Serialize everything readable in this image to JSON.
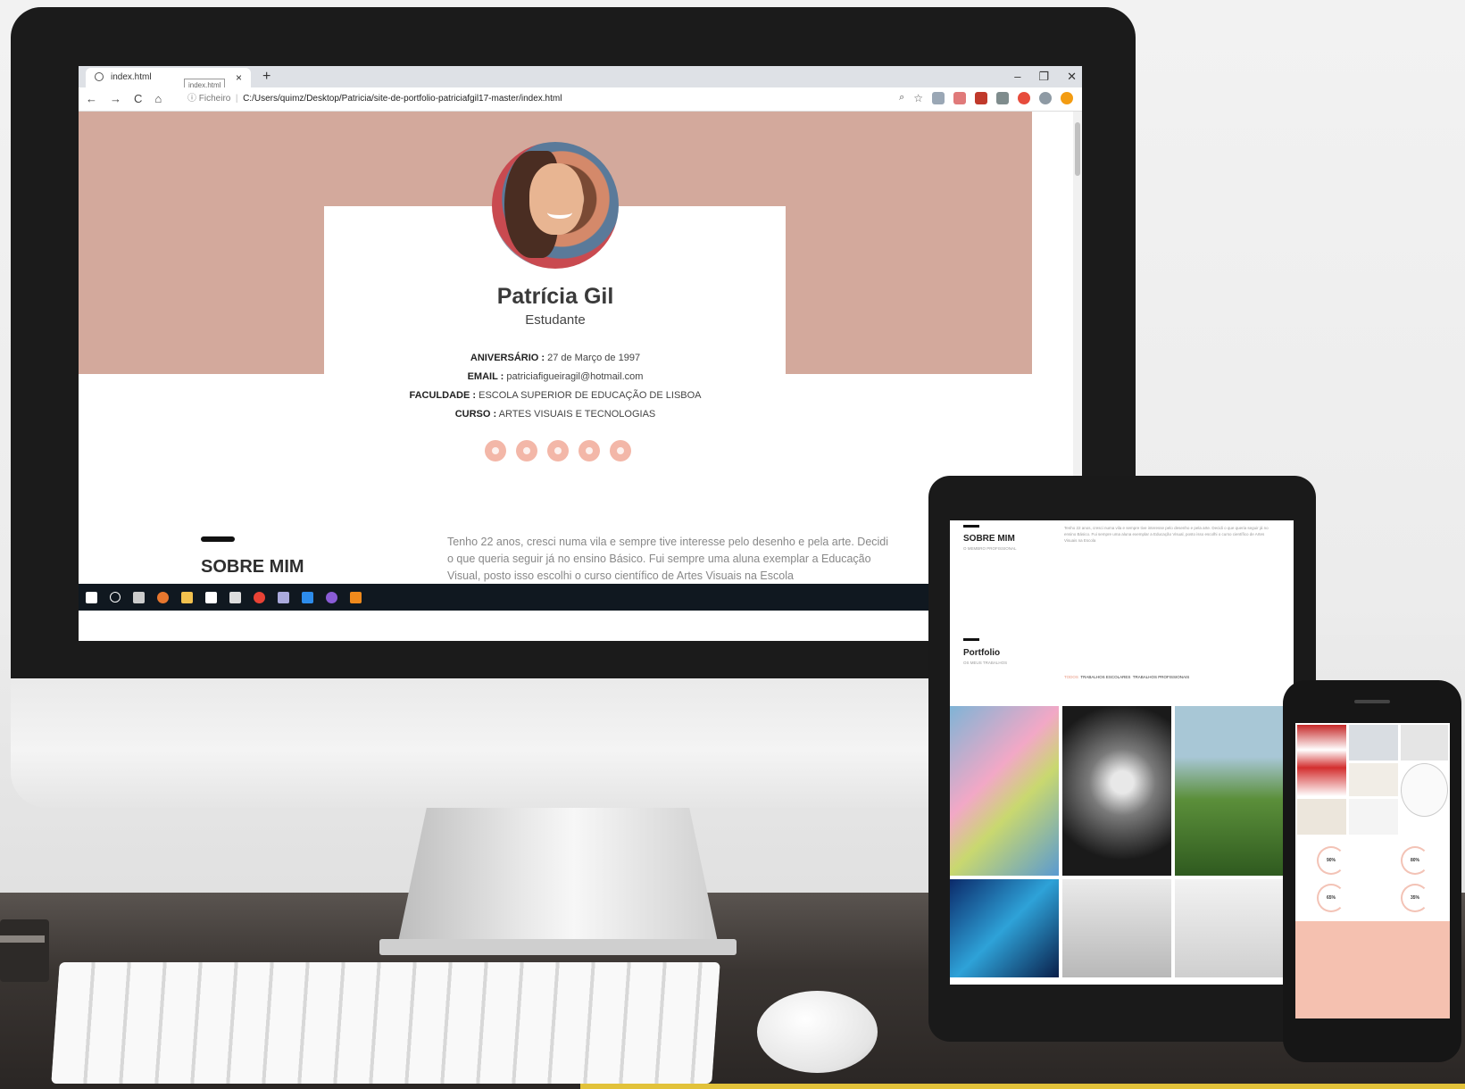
{
  "browser": {
    "tab_title": "index.html",
    "tooltip": "index.html",
    "tab_close": "×",
    "new_tab": "+",
    "minimize": "–",
    "restore": "❐",
    "close": "✕",
    "back": "←",
    "forward": "→",
    "reload": "C",
    "home": "⌂",
    "address_info": "ⓘ Ficheiro",
    "address_url": "C:/Users/quimz/Desktop/Patricia/site-de-portfolio-patriciafgil17-master/index.html",
    "zoom_icon": "⌕",
    "star_icon": "☆"
  },
  "profile": {
    "name": "Patrícia Gil",
    "role": "Estudante",
    "birthday_label": "ANIVERSÁRIO :",
    "birthday": " 27 de Março de 1997",
    "email_label": "EMAIL :",
    "email": " patriciafigueiragil@hotmail.com",
    "faculty_label": "FACULDADE :",
    "faculty": " ESCOLA SUPERIOR DE EDUCAÇÃO DE LISBOA",
    "course_label": "CURSO :",
    "course": " ARTES VISUAIS E TECNOLOGIAS",
    "social_icons": [
      "instagram-icon",
      "linkedin-icon",
      "behance-icon",
      "facebook-icon",
      "twitter-icon"
    ]
  },
  "about": {
    "title": "SOBRE MIM",
    "text": "Tenho 22 anos, cresci numa vila e sempre tive interesse pelo desenho e pela arte. Decidi o que queria seguir já no ensino Básico. Fui sempre uma aluna exemplar a Educação Visual, posto isso escolhi o curso científico de Artes Visuais na Escola"
  },
  "tablet": {
    "about_title": "SOBRE MIM",
    "about_sub": "O MEMBRO PROFISSIONAL",
    "portfolio_title": "Portfolio",
    "portfolio_sub": "OS MEUS TRABALHOS",
    "filter_all": "TODOS",
    "filter_school": "TRABALHOS ESCOLARES",
    "filter_pro": "TRABALHOS PROFISSIONAIS"
  },
  "phone": {
    "skill_values": [
      "90%",
      "80%",
      "65%",
      "35%"
    ]
  },
  "colors": {
    "hero": "#d3a99c",
    "accent": "#f3b7a8",
    "footer": "#f5c1b0"
  }
}
